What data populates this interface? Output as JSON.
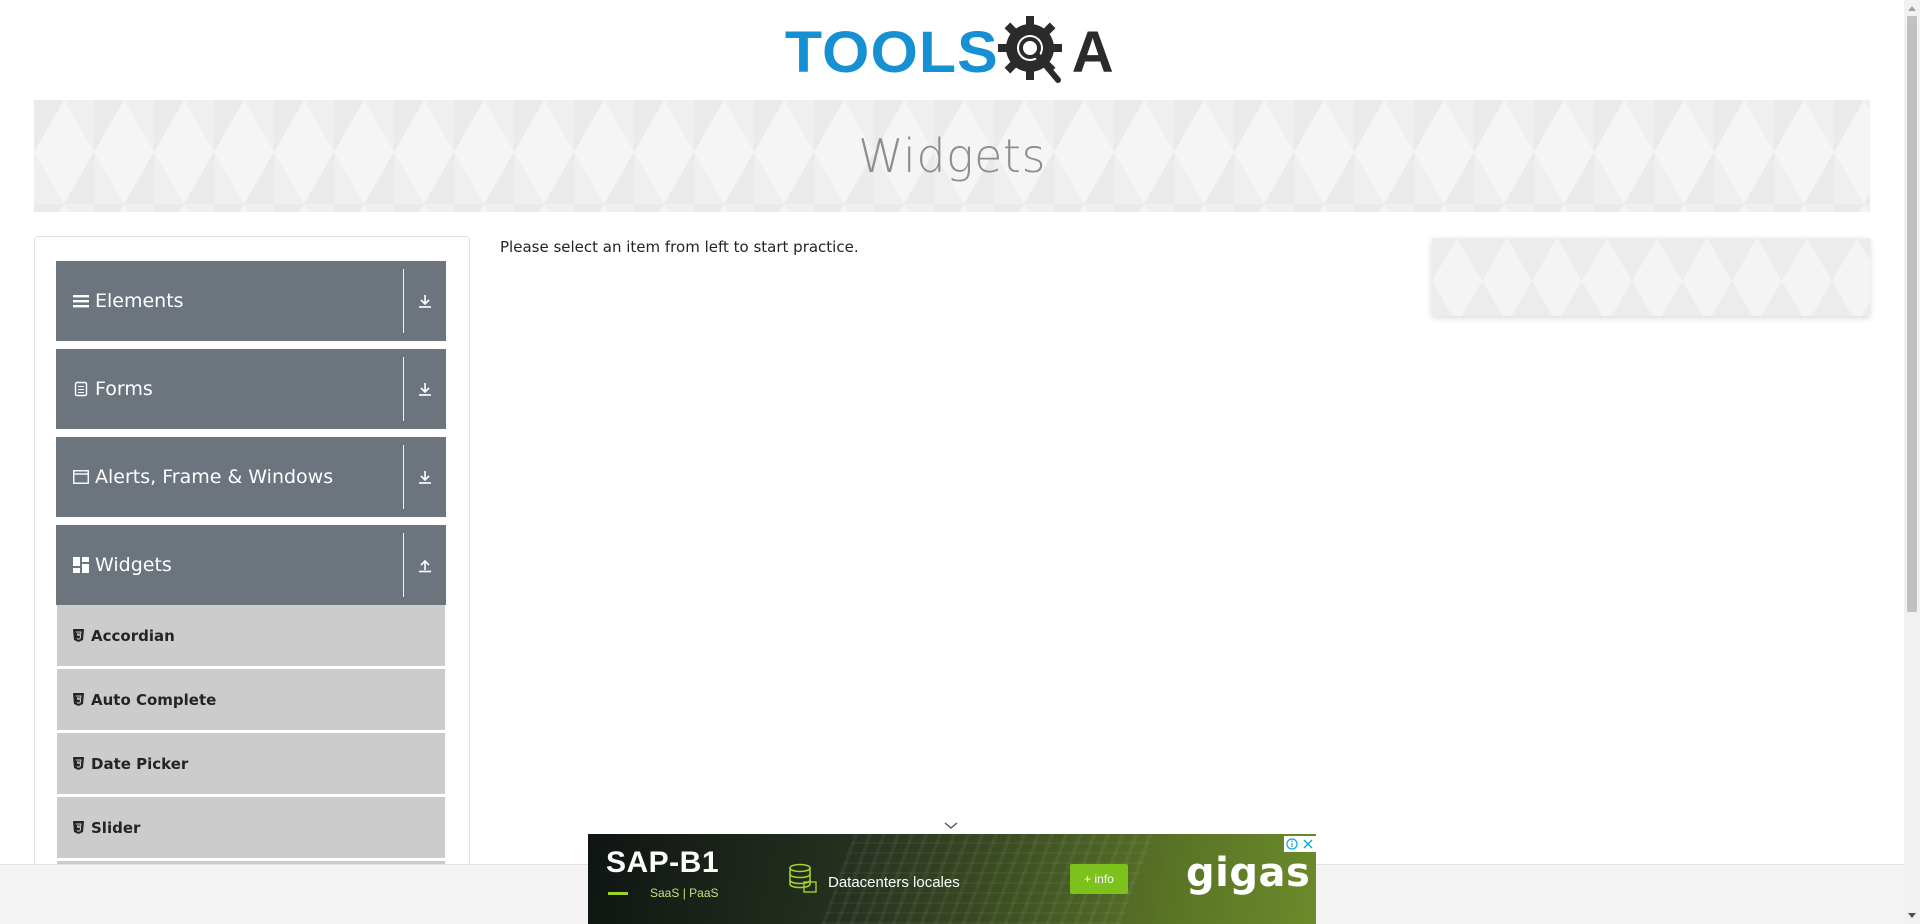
{
  "header": {
    "logo_text": "TOOLS",
    "logo_suffix": "A",
    "logo_alt": "TOOLSQA"
  },
  "banner": {
    "title": "Widgets"
  },
  "sidebar": {
    "groups": [
      {
        "label": "Elements",
        "icon": "hamburger-icon",
        "expanded": false
      },
      {
        "label": "Forms",
        "icon": "document-icon",
        "expanded": false
      },
      {
        "label": "Alerts, Frame & Windows",
        "icon": "window-icon",
        "expanded": false
      },
      {
        "label": "Widgets",
        "icon": "dashboard-icon",
        "expanded": true
      }
    ],
    "widget_items": [
      {
        "label": "Accordian",
        "icon": "html5-icon"
      },
      {
        "label": "Auto Complete",
        "icon": "html5-icon"
      },
      {
        "label": "Date Picker",
        "icon": "html5-icon"
      },
      {
        "label": "Slider",
        "icon": "html5-icon"
      }
    ]
  },
  "main": {
    "message": "Please select an item from left to start practice."
  },
  "ad": {
    "title": "SAP-B1",
    "subtitle": "SaaS | PaaS",
    "middle_text": "Datacenters locales",
    "cta": "+ info",
    "brand": "gigas"
  },
  "colors": {
    "brand_blue": "#1590d2",
    "menu_group_bg": "#6c757d",
    "menu_item_bg": "#cccccc",
    "ad_accent": "#7cc11c"
  }
}
